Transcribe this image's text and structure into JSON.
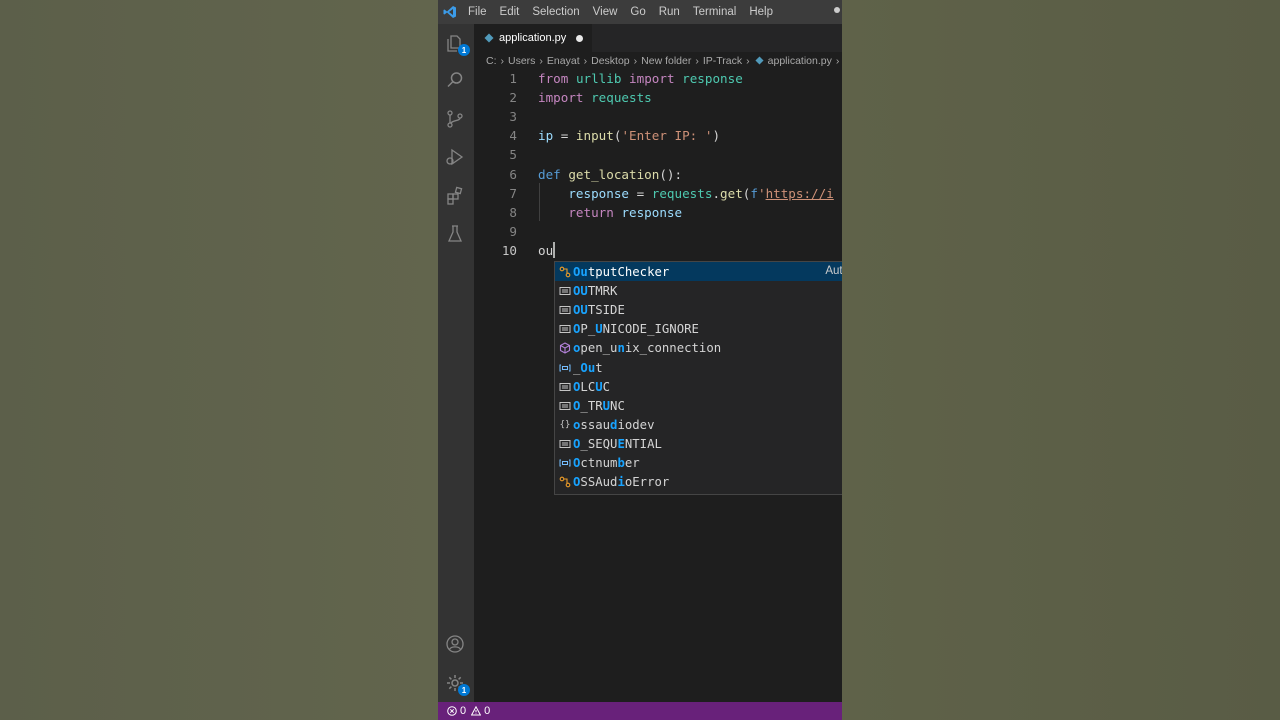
{
  "menu": [
    "File",
    "Edit",
    "Selection",
    "View",
    "Go",
    "Run",
    "Terminal",
    "Help"
  ],
  "activity_bar": {
    "explorer_badge": "1",
    "settings_badge": "1"
  },
  "tab": {
    "label": "application.py",
    "dirty": true
  },
  "breadcrumb": [
    "C:",
    "Users",
    "Enayat",
    "Desktop",
    "New folder",
    "IP-Track",
    "application.py"
  ],
  "editor": {
    "line_numbers": [
      "1",
      "2",
      "3",
      "4",
      "5",
      "6",
      "7",
      "8",
      "9",
      "10"
    ],
    "lines": [
      [
        {
          "t": "from",
          "c": "kw"
        },
        {
          "t": " "
        },
        {
          "t": "urllib",
          "c": "mod"
        },
        {
          "t": " "
        },
        {
          "t": "import",
          "c": "kw"
        },
        {
          "t": " "
        },
        {
          "t": "response",
          "c": "mod"
        }
      ],
      [
        {
          "t": "import",
          "c": "kw"
        },
        {
          "t": " "
        },
        {
          "t": "requests",
          "c": "mod"
        }
      ],
      [],
      [
        {
          "t": "ip",
          "c": "var"
        },
        {
          "t": " = "
        },
        {
          "t": "input",
          "c": "fn"
        },
        {
          "t": "("
        },
        {
          "t": "'Enter IP: '",
          "c": "str"
        },
        {
          "t": ")"
        }
      ],
      [],
      [
        {
          "t": "def",
          "c": "kwb"
        },
        {
          "t": " "
        },
        {
          "t": "get_location",
          "c": "fn"
        },
        {
          "t": "():"
        }
      ],
      [
        {
          "t": "    "
        },
        {
          "t": "response",
          "c": "var"
        },
        {
          "t": " = "
        },
        {
          "t": "requests",
          "c": "mod"
        },
        {
          "t": "."
        },
        {
          "t": "get",
          "c": "fn"
        },
        {
          "t": "("
        },
        {
          "t": "f",
          "c": "kwb"
        },
        {
          "t": "'",
          "c": "str"
        },
        {
          "t": "https://i",
          "c": "url"
        }
      ],
      [
        {
          "t": "    "
        },
        {
          "t": "return",
          "c": "kw"
        },
        {
          "t": " "
        },
        {
          "t": "response",
          "c": "var"
        }
      ],
      [],
      [
        {
          "t": "ou"
        }
      ]
    ]
  },
  "suggest": {
    "items": [
      {
        "label": "OutputChecker",
        "hl": 2,
        "kind": "class",
        "detail": "Auto"
      },
      {
        "label": "OUTMRK",
        "hl": 2,
        "kind": "constant"
      },
      {
        "label": "OUTSIDE",
        "hl": 2,
        "kind": "constant"
      },
      {
        "label": "OP_UNICODE_IGNORE",
        "hl_idx": [
          0,
          3
        ],
        "kind": "constant"
      },
      {
        "label": "open_unix_connection",
        "hl_idx": [
          0,
          6
        ],
        "kind": "method"
      },
      {
        "label": "_Out",
        "hl_idx": [
          1,
          2
        ],
        "kind": "variable"
      },
      {
        "label": "OLCUC",
        "hl_idx": [
          0,
          3
        ],
        "kind": "constant"
      },
      {
        "label": "O_TRUNC",
        "hl_idx": [
          0,
          4
        ],
        "kind": "constant"
      },
      {
        "label": "ossaudiodev",
        "hl_idx": [
          0,
          5
        ],
        "kind": "module"
      },
      {
        "label": "O_SEQUENTIAL",
        "hl_idx": [
          0,
          6
        ],
        "kind": "constant"
      },
      {
        "label": "Octnumber",
        "hl_idx": [
          0,
          6
        ],
        "kind": "variable"
      },
      {
        "label": "OSSAudioError",
        "hl_idx": [
          0,
          6
        ],
        "kind": "class"
      }
    ]
  },
  "status": {
    "errors": "0",
    "warnings": "0"
  },
  "colors": {
    "statusbar": "#68217a",
    "selected": "#04395e",
    "highlight": "#18a3ff"
  }
}
